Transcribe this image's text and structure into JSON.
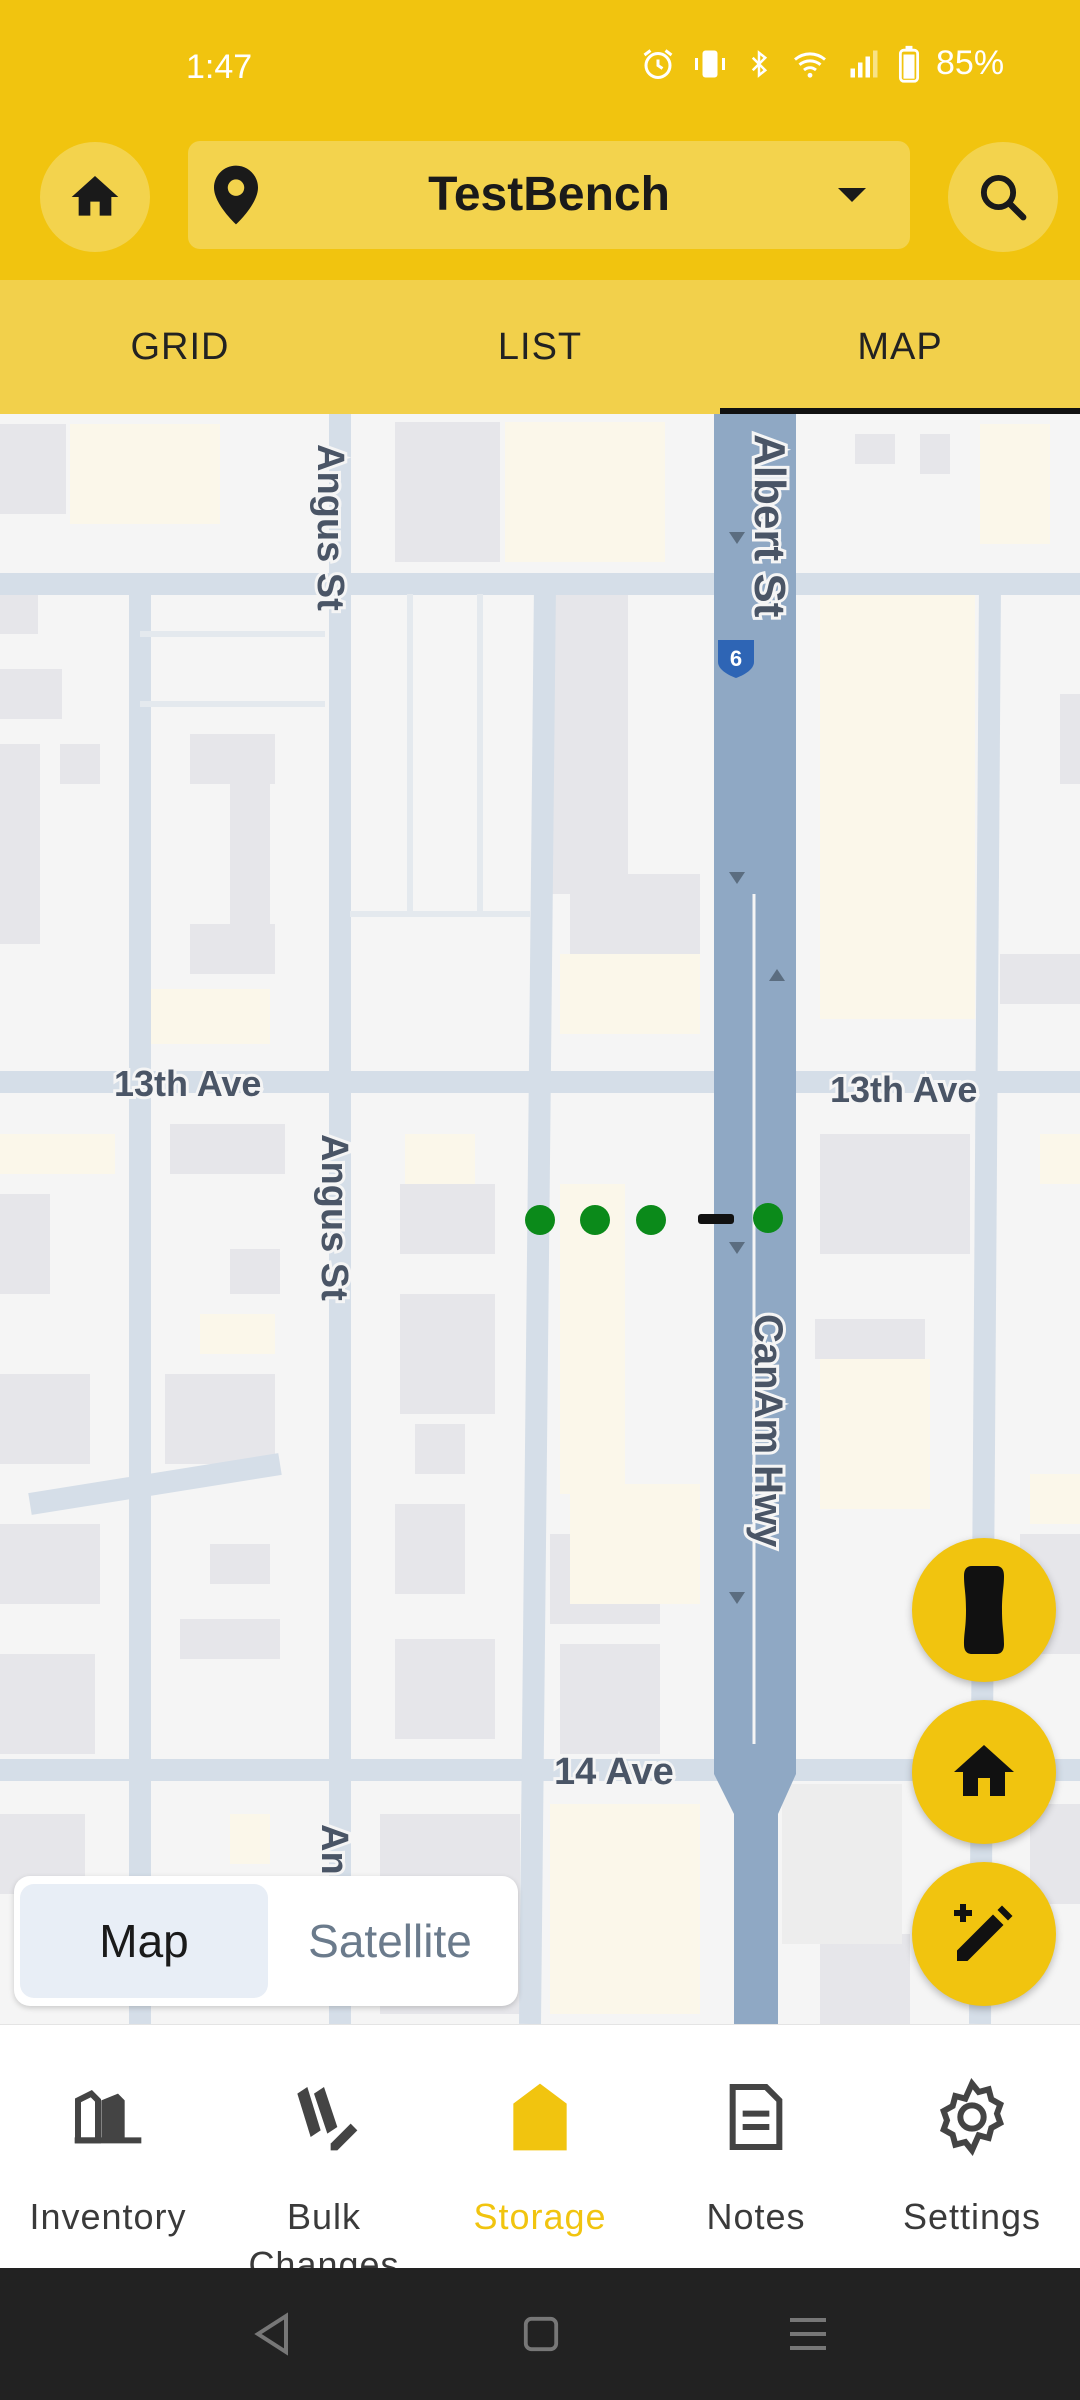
{
  "status_bar": {
    "time": "1:47",
    "battery": "85%"
  },
  "header": {
    "location": "TestBench"
  },
  "tabs": [
    {
      "label": "GRID"
    },
    {
      "label": "LIST"
    },
    {
      "label": "MAP"
    }
  ],
  "active_tab": "MAP",
  "map": {
    "streets": {
      "albert": "Albert St",
      "angus_top": "Angus St",
      "angus_mid": "Angus St",
      "angus_bottom": "An",
      "ave13_left": "13th Ave",
      "ave13_right": "13th Ave",
      "canam": "CanAm Hwy",
      "ave14": "14 Ave"
    },
    "route_shield": "6",
    "toggle": {
      "map": "Map",
      "satellite": "Satellite",
      "selected": "Map"
    }
  },
  "fabs": [
    {
      "icon": "car-icon"
    },
    {
      "icon": "home-icon"
    },
    {
      "icon": "add-edit-icon"
    }
  ],
  "bottom_nav": [
    {
      "label": "Inventory",
      "icon": "shelf-icon"
    },
    {
      "label": "Bulk Changes",
      "icon": "bulk-edit-icon"
    },
    {
      "label": "Storage",
      "icon": "storage-icon"
    },
    {
      "label": "Notes",
      "icon": "note-icon"
    },
    {
      "label": "Settings",
      "icon": "gear-icon"
    }
  ],
  "active_nav": "Storage",
  "colors": {
    "accent": "#f1c40f",
    "marker": "#0b8a1a",
    "highway": "#8fa8c4"
  }
}
